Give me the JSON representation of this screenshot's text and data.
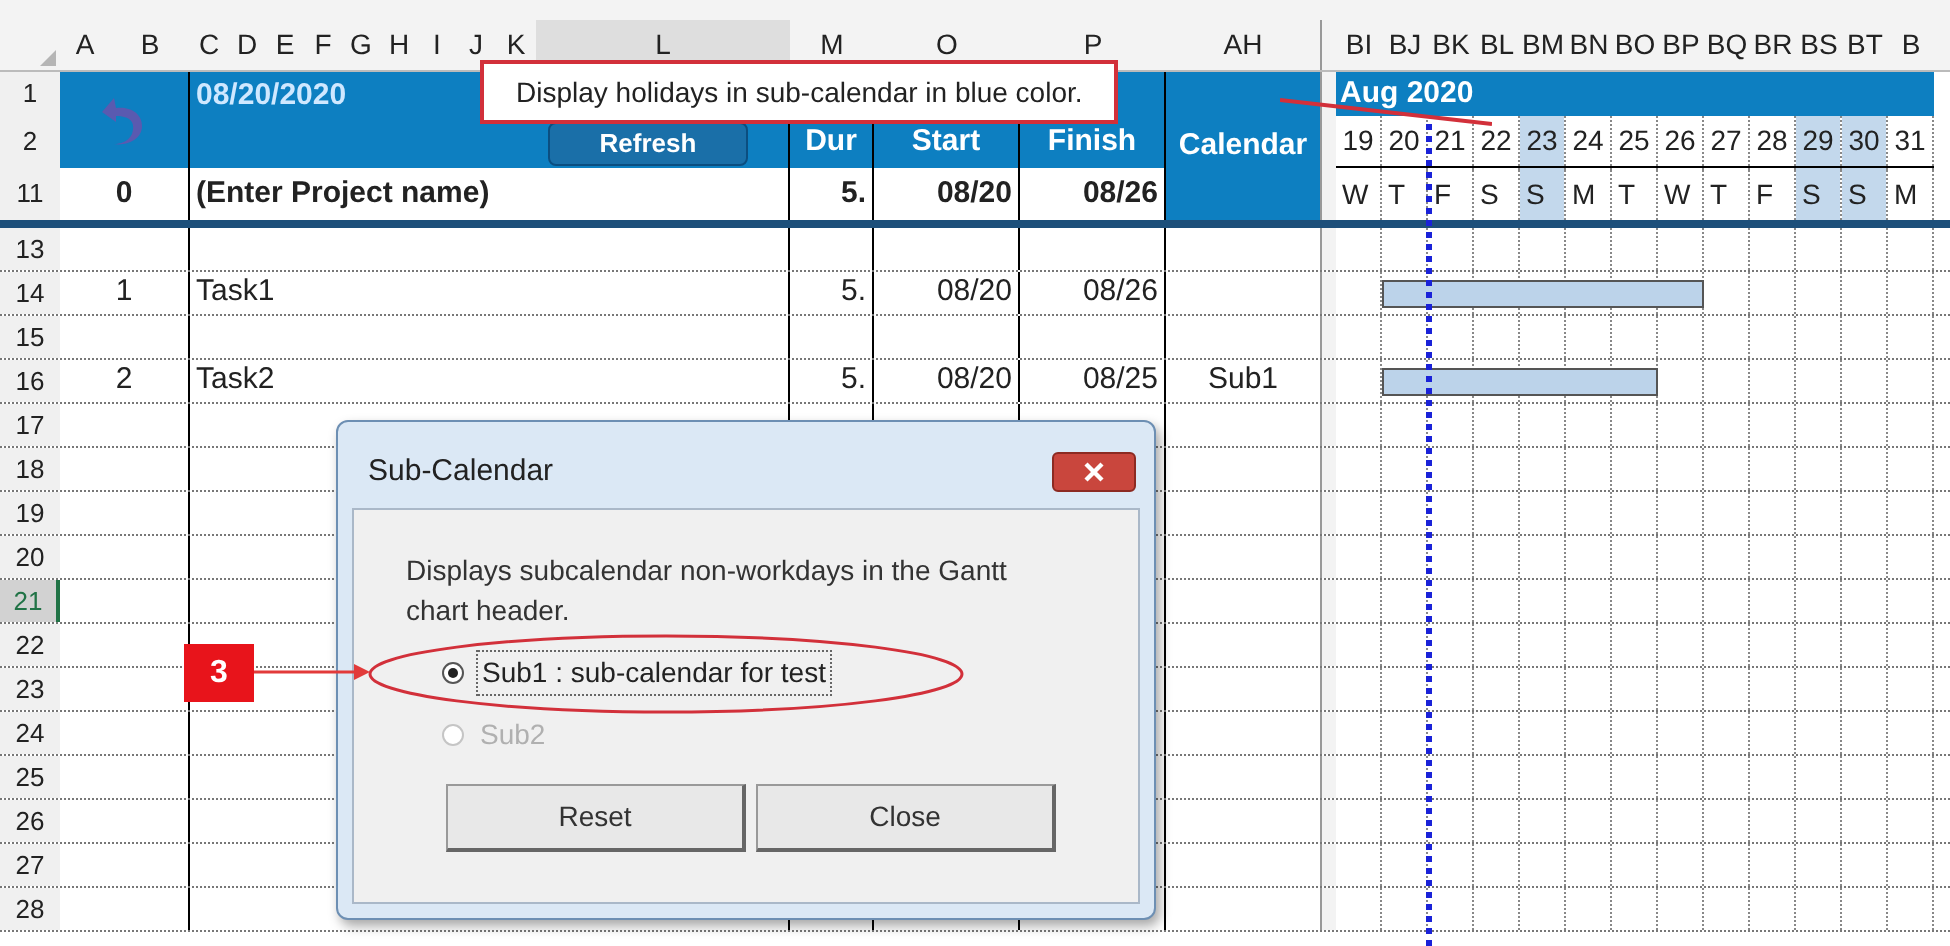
{
  "column_headers": [
    "A",
    "B",
    "C",
    "D",
    "E",
    "F",
    "G",
    "H",
    "I",
    "J",
    "K",
    "L",
    "M",
    "O",
    "P",
    "AH"
  ],
  "gantt_column_headers": [
    "BI",
    "BJ",
    "BK",
    "BL",
    "BM",
    "BN",
    "BO",
    "BP",
    "BQ",
    "BR",
    "BS",
    "BT",
    "B"
  ],
  "top_rows": [
    "1",
    "2"
  ],
  "header": {
    "date": "08/20/2020",
    "refresh_button": "Refresh",
    "columns": [
      "Dur",
      "Start",
      "Finish",
      "Calendar"
    ],
    "month": "Aug 2020"
  },
  "timeline": [
    {
      "date": "19",
      "weekday": "W",
      "holiday": false
    },
    {
      "date": "20",
      "weekday": "T",
      "holiday": false
    },
    {
      "date": "21",
      "weekday": "F",
      "holiday": false
    },
    {
      "date": "22",
      "weekday": "S",
      "holiday": false
    },
    {
      "date": "23",
      "weekday": "S",
      "holiday": true
    },
    {
      "date": "24",
      "weekday": "M",
      "holiday": false
    },
    {
      "date": "25",
      "weekday": "T",
      "holiday": false
    },
    {
      "date": "26",
      "weekday": "W",
      "holiday": false
    },
    {
      "date": "27",
      "weekday": "T",
      "holiday": false
    },
    {
      "date": "28",
      "weekday": "F",
      "holiday": false
    },
    {
      "date": "29",
      "weekday": "S",
      "holiday": true
    },
    {
      "date": "30",
      "weekday": "S",
      "holiday": true
    },
    {
      "date": "31",
      "weekday": "M",
      "holiday": false
    }
  ],
  "project_row": {
    "row": "11",
    "number": "0",
    "name": "(Enter Project name)",
    "dur": "5.",
    "start": "08/20",
    "finish": "08/26"
  },
  "rows": [
    {
      "row": "13",
      "kind": "blank",
      "selected": false
    },
    {
      "row": "14",
      "kind": "task",
      "selected": false,
      "number": "1",
      "name": "Task1",
      "dur": "5.",
      "start": "08/20",
      "finish": "08/26"
    },
    {
      "row": "15",
      "kind": "blank",
      "selected": false
    },
    {
      "row": "16",
      "kind": "task",
      "selected": false,
      "number": "2",
      "name": "Task2",
      "dur": "5.",
      "start": "08/20",
      "finish": "08/25",
      "calendar": "Sub1"
    },
    {
      "row": "17",
      "kind": "blank",
      "selected": false
    },
    {
      "row": "18",
      "kind": "blank",
      "selected": false
    },
    {
      "row": "19",
      "kind": "blank",
      "selected": false
    },
    {
      "row": "20",
      "kind": "blank",
      "selected": false
    },
    {
      "row": "21",
      "kind": "blank",
      "selected": true
    },
    {
      "row": "22",
      "kind": "blank",
      "selected": false
    },
    {
      "row": "23",
      "kind": "blank",
      "selected": false
    },
    {
      "row": "24",
      "kind": "blank",
      "selected": false
    },
    {
      "row": "25",
      "kind": "blank",
      "selected": false
    },
    {
      "row": "26",
      "kind": "blank",
      "selected": false
    },
    {
      "row": "27",
      "kind": "blank",
      "selected": false
    },
    {
      "row": "28",
      "kind": "blank",
      "selected": false
    }
  ],
  "dialog": {
    "title": "Sub-Calendar",
    "description": "Displays subcalendar non-workdays in the Gantt chart header.",
    "options": [
      {
        "label": "Sub1 : sub-calendar for test",
        "selected": true,
        "disabled": false
      },
      {
        "label": "Sub2",
        "selected": false,
        "disabled": true
      }
    ],
    "buttons": [
      "Reset",
      "Close"
    ]
  },
  "annotations": {
    "step_number": "3",
    "tooltip": "Display holidays in sub-calendar in blue color."
  }
}
